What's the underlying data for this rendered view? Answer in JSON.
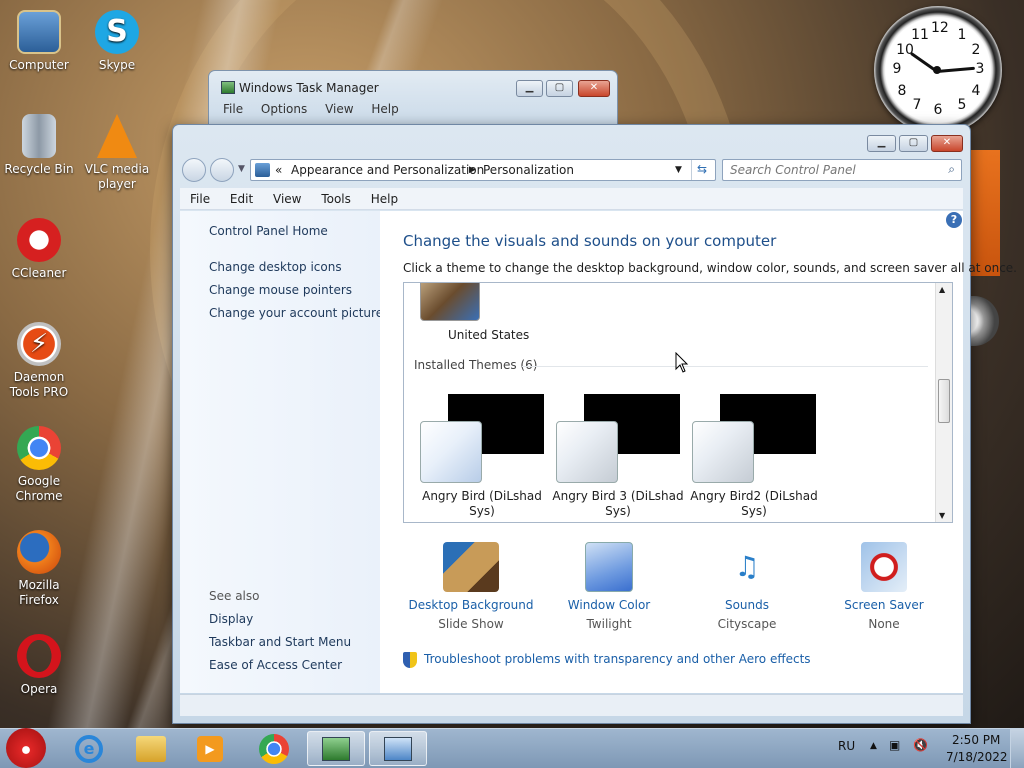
{
  "desktop": {
    "icons": [
      {
        "label": "Computer"
      },
      {
        "label": "Skype"
      },
      {
        "label": "Recycle Bin"
      },
      {
        "label": "VLC media player"
      },
      {
        "label": "CCleaner"
      },
      {
        "label": "Daemon Tools PRO"
      },
      {
        "label": "Google Chrome"
      },
      {
        "label": "Mozilla Firefox"
      },
      {
        "label": "Opera"
      }
    ],
    "clock_numbers": [
      "12",
      "1",
      "2",
      "3",
      "4",
      "5",
      "6",
      "7",
      "8",
      "9",
      "10",
      "11"
    ]
  },
  "task_manager": {
    "title": "Windows Task Manager",
    "menu": [
      "File",
      "Options",
      "View",
      "Help"
    ]
  },
  "window": {
    "breadcrumb": {
      "sep": "«",
      "items": [
        "Appearance and Personalization",
        "Personalization"
      ]
    },
    "search_placeholder": "Search Control Panel",
    "menu": [
      "File",
      "Edit",
      "View",
      "Tools",
      "Help"
    ],
    "help_glyph": "?",
    "left": {
      "home": "Control Panel Home",
      "links": [
        "Change desktop icons",
        "Change mouse pointers",
        "Change your account picture"
      ],
      "see_also_header": "See also",
      "see_also": [
        "Display",
        "Taskbar and Start Menu",
        "Ease of Access Center"
      ]
    },
    "heading": "Change the visuals and sounds on your computer",
    "subheading": "Click a theme to change the desktop background, window color, sounds, and screen saver all at once.",
    "top_theme": "United States",
    "installed_header": "Installed Themes (6)",
    "themes": [
      {
        "name1": "Angry Bird (DiLshad",
        "name2": "Sys)"
      },
      {
        "name1": "Angry Bird 3 (DiLshad",
        "name2": "Sys)"
      },
      {
        "name1": "Angry Bird2 (DiLshad",
        "name2": "Sys)"
      }
    ],
    "options": [
      {
        "title": "Desktop Background",
        "value": "Slide Show"
      },
      {
        "title": "Window Color",
        "value": "Twilight"
      },
      {
        "title": "Sounds",
        "value": "Cityscape"
      },
      {
        "title": "Screen Saver",
        "value": "None"
      }
    ],
    "troubleshoot": "Troubleshoot problems with transparency and other Aero effects"
  },
  "taskbar": {
    "lang": "RU",
    "time": "2:50 PM",
    "date": "7/18/2022"
  },
  "colors": {
    "link": "#1a5fa8",
    "heading": "#1e4f8a"
  }
}
